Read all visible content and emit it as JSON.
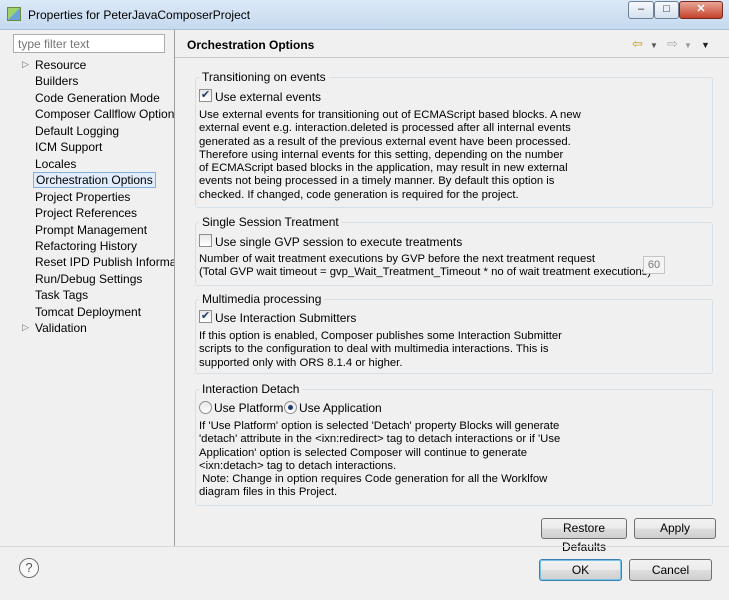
{
  "window": {
    "title": "Properties for PeterJavaComposerProject",
    "min_label": "–",
    "max_label": "□",
    "close_label": "✕"
  },
  "filter": {
    "placeholder": "type filter text"
  },
  "tree": [
    {
      "label": "Resource",
      "expandable": true
    },
    {
      "label": "Builders"
    },
    {
      "label": "Code Generation Mode"
    },
    {
      "label": "Composer Callflow Option"
    },
    {
      "label": "Default Logging"
    },
    {
      "label": "ICM Support"
    },
    {
      "label": "Locales"
    },
    {
      "label": "Orchestration Options",
      "selected": true
    },
    {
      "label": "Project Properties"
    },
    {
      "label": "Project References"
    },
    {
      "label": "Prompt Management"
    },
    {
      "label": "Refactoring History"
    },
    {
      "label": "Reset IPD Publish Informati"
    },
    {
      "label": "Run/Debug Settings"
    },
    {
      "label": "Task Tags"
    },
    {
      "label": "Tomcat Deployment"
    },
    {
      "label": "Validation",
      "expandable": true
    }
  ],
  "header": {
    "title": "Orchestration Options",
    "back_icon": "back-arrow-icon",
    "forward_icon": "forward-arrow-icon",
    "menu_icon": "view-menu-icon"
  },
  "groups": {
    "transitioning": {
      "title": "Transitioning on events",
      "checkbox_label": "Use external events",
      "checked": true,
      "description": "Use external events for transitioning out of ECMAScript based blocks. A new\nexternal event e.g. interaction.deleted is processed after all internal events\ngenerated as a result of the previous external event have been processed.\nTherefore using internal events for this setting, depending on the number\nof ECMAScript based blocks in the application, may result in new external\nevents not being processed in a timely manner. By default this option is\nchecked. If changed, code generation is required for the project."
    },
    "session": {
      "title": "Single Session Treatment",
      "checkbox_label": "Use single GVP session to execute treatments",
      "checked": false,
      "description": "Number of wait treatment executions by GVP before the next treatment request\n(Total GVP wait timeout = gvp_Wait_Treatment_Timeout * no of wait treatment executions)",
      "count_value": "60"
    },
    "multimedia": {
      "title": "Multimedia processing",
      "checkbox_label": "Use Interaction Submitters",
      "checked": true,
      "description": "If this option is enabled, Composer publishes some Interaction Submitter\nscripts to the configuration to deal with multimedia interactions. This is\nsupported only with ORS 8.1.4 or higher."
    },
    "detach": {
      "title": "Interaction Detach",
      "option_platform": "Use Platform",
      "option_application": "Use Application",
      "selected": "Use Application",
      "description": "If 'Use Platform' option is selected 'Detach' property Blocks will generate\n'detach' attribute in the <ixn:redirect> tag to detach interactions or if 'Use\nApplication' option is selected Composer will continue to generate\n<ixn:detach> tag to detach interactions.\n Note: Change in option requires Code generation for all the Worklfow\ndiagram files in this Project."
    }
  },
  "buttons": {
    "restore_defaults": "Restore Defaults",
    "apply": "Apply",
    "ok": "OK",
    "cancel": "Cancel",
    "help": "?"
  }
}
